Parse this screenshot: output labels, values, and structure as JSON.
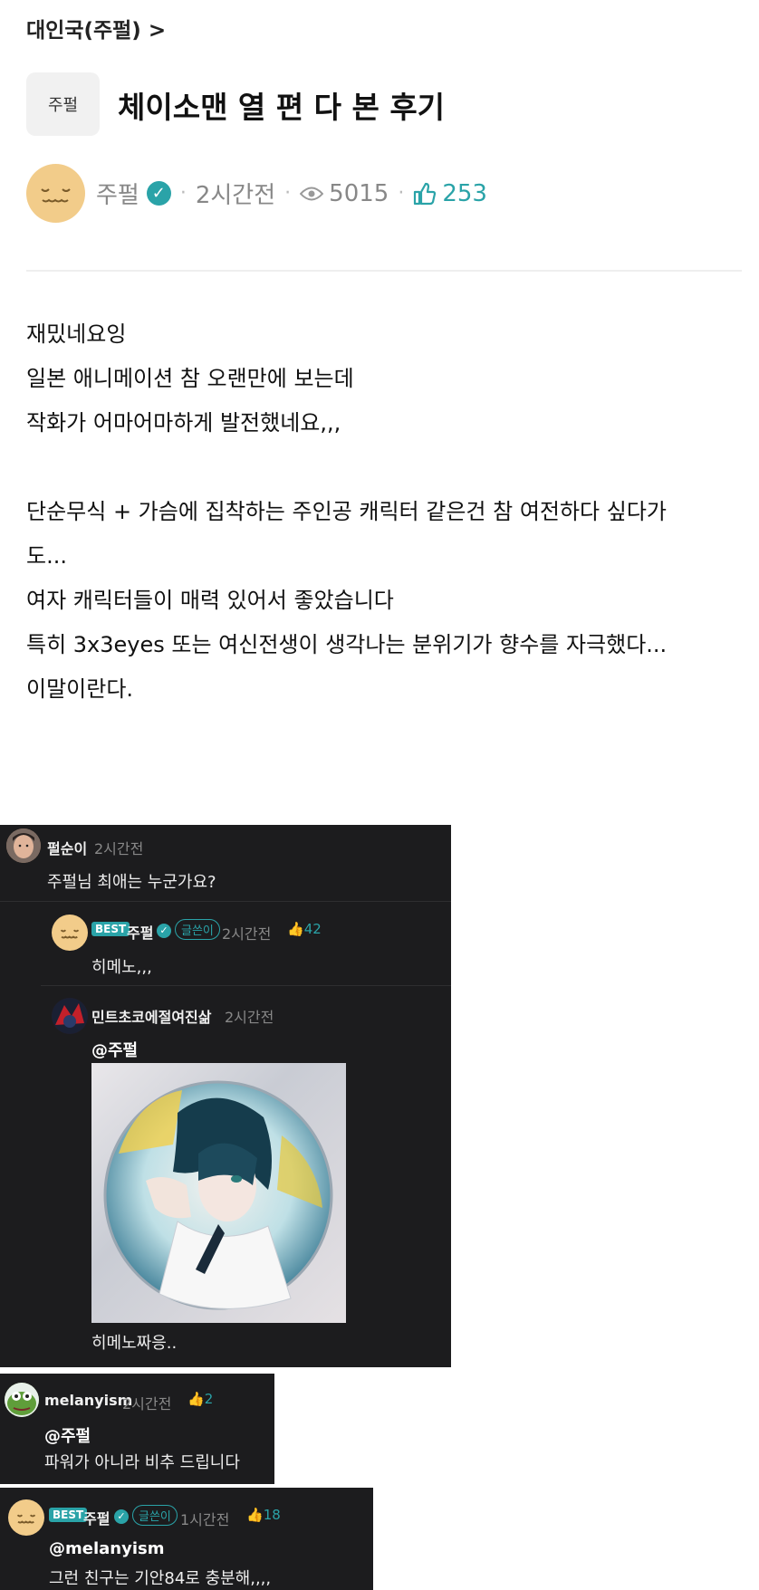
{
  "breadcrumb": "대인국(주펄) >",
  "post": {
    "category": "주펄",
    "title": "체이소맨 열 편 다 본 후기",
    "author": "주펄",
    "time": "2시간전",
    "views": "5015",
    "likes": "253",
    "body": [
      "재밌네요잉",
      "일본 애니메이션 참 오랜만에 보는데",
      "작화가 어마어마하게 발전했네요,,,",
      "",
      "단순무식 + 가슴에 집착하는 주인공 캐릭터 같은건 참 여전하다 싶다가",
      "도...",
      "여자 캐릭터들이 매력 있어서 좋았습니다",
      "특히 3x3eyes 또는 여신전생이 생각나는 분위기가 향수를 자극했다...",
      "이말이란다."
    ]
  },
  "comments": [
    {
      "user": "펄순이",
      "time": "2시간전",
      "text": "주펄님 최애는 누군가요?"
    },
    {
      "badge": "BEST",
      "user": "주펄",
      "role": "글쓴이",
      "time": "2시간전",
      "likes": "42",
      "text": "히메노,,,"
    },
    {
      "user": "민트초코에절여진삶",
      "time": "2시간전",
      "mention": "@주펄",
      "text": "히메노짜응.."
    },
    {
      "user": "melanyism",
      "time": "2시간전",
      "likes": "2",
      "mention": "@주펄",
      "text": "파워가 아니라 비추 드립니다"
    },
    {
      "badge": "BEST",
      "user": "주펄",
      "role": "글쓴이",
      "time": "1시간전",
      "likes": "18",
      "mention": "@melanyism",
      "text": "그런 친구는 기안84로 충분해,,,,"
    }
  ],
  "icons": {
    "verified": "check-badge-icon",
    "views": "eye-icon",
    "likes": "thumbs-up-icon"
  },
  "colors": {
    "accent": "#2aa3a8",
    "dark_bg": "#1c1c1e",
    "avatar": "#f2cc8a"
  }
}
